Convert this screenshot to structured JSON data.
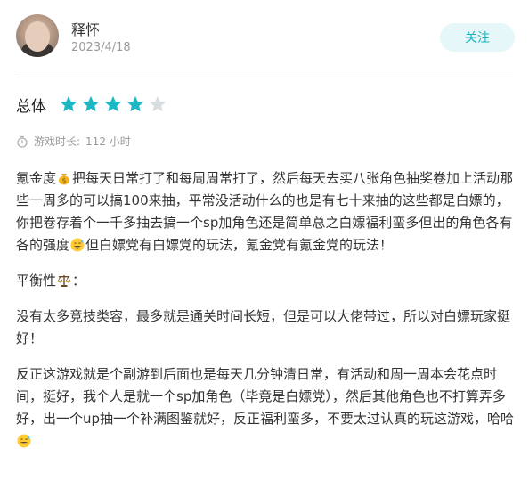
{
  "review": {
    "username": "释怀",
    "date": "2023/4/18",
    "follow_label": "关注",
    "rating_label": "总体",
    "rating": 4,
    "rating_max": 5,
    "playtime_label": "游戏时长:",
    "playtime_value": "112 小时",
    "para1": {
      "a": "氪金度",
      "b": "把每天日常打了和每周周常打了，然后每天去买八张角色抽奖卷加上活动那些一周多的可以搞100来抽，平常没活动什么的也是有七十来抽的这些都是白嫖的，你把卷存着个一千多抽去搞一个sp加角色还是简单总之白嫖福利蛮多但出的角色各有各的强度",
      "c": "但白嫖党有白嫖党的玩法，氪金党有氪金党的玩法！"
    },
    "para2": {
      "a": "平衡性",
      "b": "："
    },
    "para3": "没有太多竞技类容，最多就是通关时间长短，但是可以大佬带过，所以对白嫖玩家挺好！",
    "para4": "反正这游戏就是个副游到后面也是每天几分钟清日常，有活动和周一周本会花点时间，挺好，我个人是就一个sp加角色（毕竟是白嫖党），然后其他角色也不打算弄多好，出一个up抽一个补满图鉴就好，反正福利蛮多，不要太过认真的玩这游戏，哈哈"
  },
  "icons": [
    "money-bag-icon",
    "grinning-sweat-emoji",
    "balance-scale-emoji",
    "timer-icon",
    "star-icon"
  ],
  "colors": {
    "accent": "#1cb8c4",
    "star_filled": "#1cb8c4",
    "star_empty": "#d9dde0",
    "follow_bg": "#e5f7f8"
  }
}
